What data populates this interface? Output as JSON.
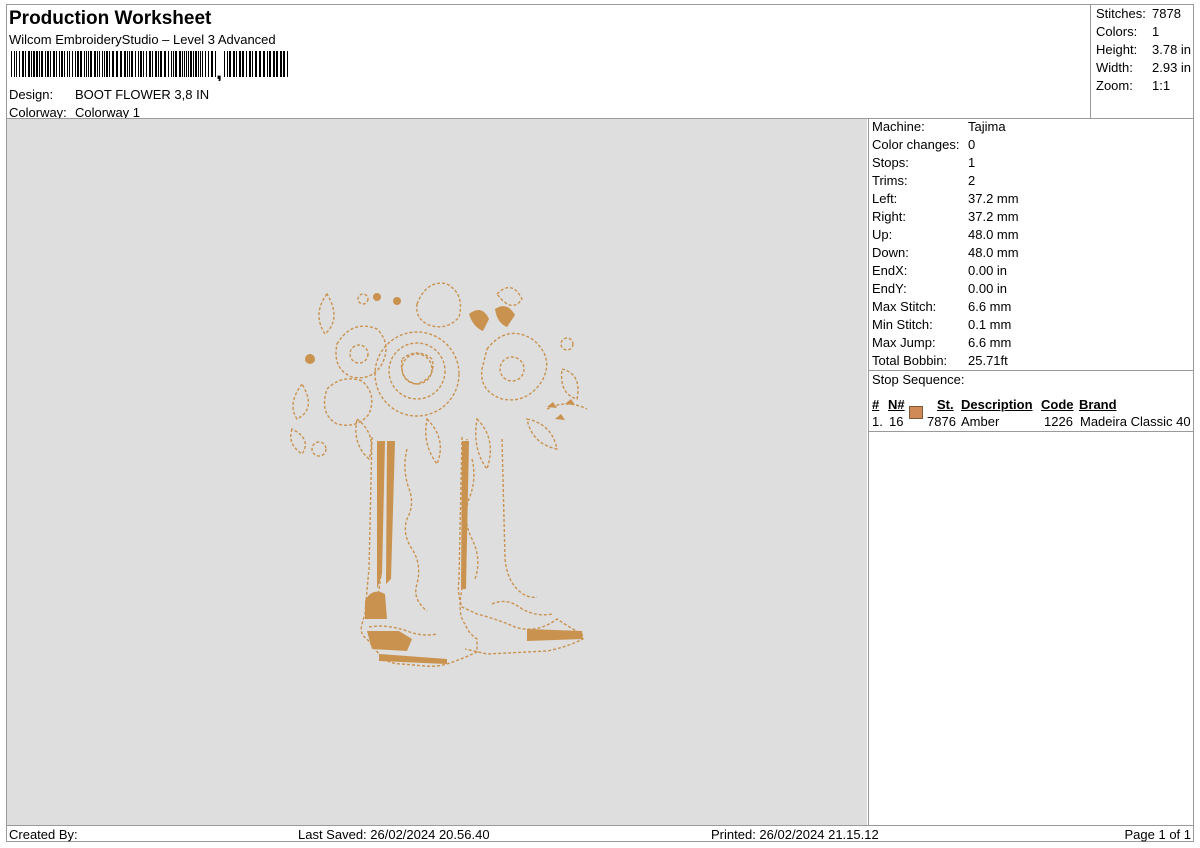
{
  "header": {
    "title": "Production Worksheet",
    "subtitle": "Wilcom EmbroideryStudio – Level 3 Advanced",
    "design_label": "Design:",
    "design_value": "BOOT FLOWER 3,8 IN",
    "colorway_label": "Colorway:",
    "colorway_value": "Colorway 1"
  },
  "summary": [
    {
      "label": "Stitches:",
      "value": "7878"
    },
    {
      "label": "Colors:",
      "value": "1"
    },
    {
      "label": "Height:",
      "value": "3.78 in"
    },
    {
      "label": "Width:",
      "value": "2.93 in"
    },
    {
      "label": "Zoom:",
      "value": "1:1"
    }
  ],
  "machine_info": [
    {
      "label": "Machine:",
      "value": "Tajima"
    },
    {
      "label": "Color changes:",
      "value": "0"
    },
    {
      "label": "Stops:",
      "value": "1"
    },
    {
      "label": "Trims:",
      "value": "2"
    },
    {
      "label": "Left:",
      "value": "37.2 mm"
    },
    {
      "label": "Right:",
      "value": "37.2 mm"
    },
    {
      "label": "Up:",
      "value": "48.0 mm"
    },
    {
      "label": "Down:",
      "value": "48.0 mm"
    },
    {
      "label": "EndX:",
      "value": "0.00 in"
    },
    {
      "label": "EndY:",
      "value": "0.00 in"
    },
    {
      "label": "Max Stitch:",
      "value": "6.6 mm"
    },
    {
      "label": "Min Stitch:",
      "value": "0.1 mm"
    },
    {
      "label": "Max Jump:",
      "value": "6.6 mm"
    },
    {
      "label": "Total Bobbin:",
      "value": "25.71ft"
    }
  ],
  "stop_sequence": {
    "title": "Stop Sequence:",
    "columns": {
      "index": "#",
      "needle": "N#",
      "stitches": "St.",
      "description": "Description",
      "code": "Code",
      "brand": "Brand"
    },
    "rows": [
      {
        "index": "1.",
        "needle": "16",
        "stitches": "7876",
        "description": "Amber",
        "code": "1226",
        "brand": "Madeira Classic 40",
        "color": "#cf8a55"
      }
    ]
  },
  "footer": {
    "created_by": "Created By:",
    "last_saved": "Last Saved: 26/02/2024 20.56.40",
    "printed": "Printed: 26/02/2024 21.15.12",
    "page": "Page 1 of 1"
  },
  "design_colors": {
    "thread": "#c9924f",
    "thread_dark": "#a8743a",
    "canvas": "#dedede"
  }
}
